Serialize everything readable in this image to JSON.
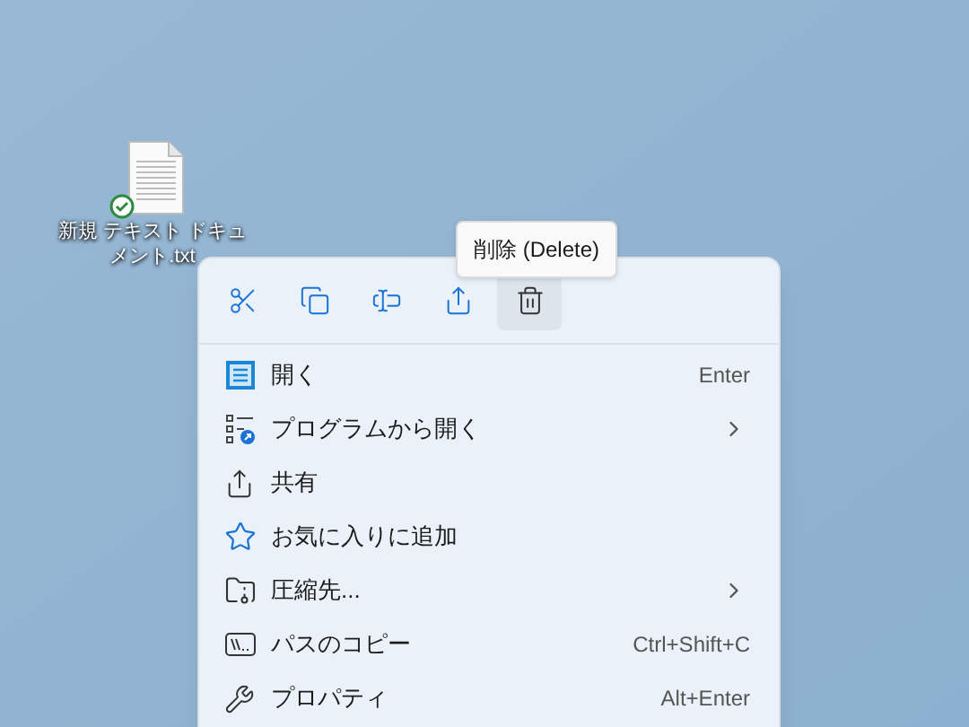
{
  "desktop_icon": {
    "label": "新規 テキスト ドキュメント.txt"
  },
  "tooltip": "削除 (Delete)",
  "toolbar": [
    {
      "kind": "cut",
      "selected": false
    },
    {
      "kind": "copy",
      "selected": false
    },
    {
      "kind": "rename",
      "selected": false
    },
    {
      "kind": "share",
      "selected": false
    },
    {
      "kind": "delete",
      "selected": true
    }
  ],
  "menu": [
    {
      "kind": "open",
      "label": "開く",
      "shortcut": "Enter",
      "submenu": false
    },
    {
      "kind": "open-with",
      "label": "プログラムから開く",
      "submenu": true
    },
    {
      "kind": "share",
      "label": "共有",
      "submenu": false
    },
    {
      "kind": "favorite",
      "label": "お気に入りに追加",
      "submenu": false
    },
    {
      "kind": "compress",
      "label": "圧縮先...",
      "submenu": true
    },
    {
      "kind": "copy-path",
      "label": "パスのコピー",
      "shortcut": "Ctrl+Shift+C",
      "submenu": false
    },
    {
      "kind": "properties",
      "label": "プロパティ",
      "shortcut": "Alt+Enter",
      "submenu": false
    }
  ]
}
